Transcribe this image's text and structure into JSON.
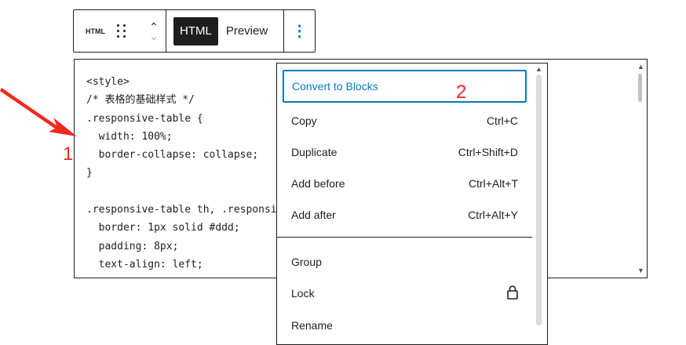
{
  "toolbar": {
    "block_name": "HTML",
    "tabs": [
      "HTML",
      "Preview"
    ],
    "active_tab": "HTML",
    "more_icon": "vertical-ellipsis"
  },
  "editor": {
    "code_lines": [
      "<style>",
      "/* 表格的基础样式 */",
      ".responsive-table {",
      "  width: 100%;",
      "  border-collapse: collapse;",
      "}",
      "",
      ".responsive-table th, .responsive-table td {",
      "  border: 1px solid #ddd;",
      "  padding: 8px;",
      "  text-align: left;",
      "}"
    ]
  },
  "menu": {
    "items": [
      {
        "label": "Convert to Blocks",
        "shortcut": ""
      },
      {
        "label": "Copy",
        "shortcut": "Ctrl+C"
      },
      {
        "label": "Duplicate",
        "shortcut": "Ctrl+Shift+D"
      },
      {
        "label": "Add before",
        "shortcut": "Ctrl+Alt+T"
      },
      {
        "label": "Add after",
        "shortcut": "Ctrl+Alt+Y"
      },
      {
        "label": "Group",
        "shortcut": ""
      },
      {
        "label": "Lock",
        "shortcut": ""
      },
      {
        "label": "Rename",
        "shortcut": ""
      }
    ]
  },
  "annotations": {
    "one": "1",
    "two": "2"
  },
  "colors": {
    "accent": "#007cba",
    "annotation": "#f0281e"
  }
}
